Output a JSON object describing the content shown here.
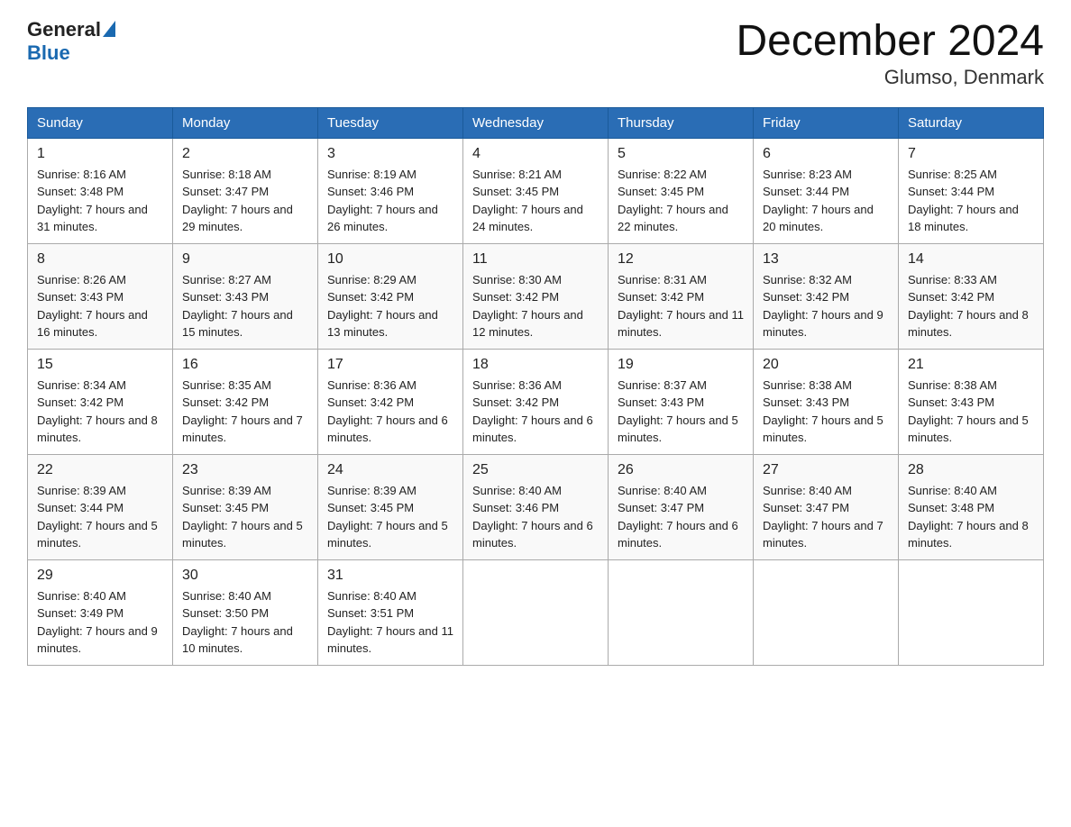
{
  "logo": {
    "general": "General",
    "blue": "Blue"
  },
  "title": "December 2024",
  "subtitle": "Glumso, Denmark",
  "days_of_week": [
    "Sunday",
    "Monday",
    "Tuesday",
    "Wednesday",
    "Thursday",
    "Friday",
    "Saturday"
  ],
  "weeks": [
    [
      {
        "day": "1",
        "sunrise": "8:16 AM",
        "sunset": "3:48 PM",
        "daylight": "7 hours and 31 minutes."
      },
      {
        "day": "2",
        "sunrise": "8:18 AM",
        "sunset": "3:47 PM",
        "daylight": "7 hours and 29 minutes."
      },
      {
        "day": "3",
        "sunrise": "8:19 AM",
        "sunset": "3:46 PM",
        "daylight": "7 hours and 26 minutes."
      },
      {
        "day": "4",
        "sunrise": "8:21 AM",
        "sunset": "3:45 PM",
        "daylight": "7 hours and 24 minutes."
      },
      {
        "day": "5",
        "sunrise": "8:22 AM",
        "sunset": "3:45 PM",
        "daylight": "7 hours and 22 minutes."
      },
      {
        "day": "6",
        "sunrise": "8:23 AM",
        "sunset": "3:44 PM",
        "daylight": "7 hours and 20 minutes."
      },
      {
        "day": "7",
        "sunrise": "8:25 AM",
        "sunset": "3:44 PM",
        "daylight": "7 hours and 18 minutes."
      }
    ],
    [
      {
        "day": "8",
        "sunrise": "8:26 AM",
        "sunset": "3:43 PM",
        "daylight": "7 hours and 16 minutes."
      },
      {
        "day": "9",
        "sunrise": "8:27 AM",
        "sunset": "3:43 PM",
        "daylight": "7 hours and 15 minutes."
      },
      {
        "day": "10",
        "sunrise": "8:29 AM",
        "sunset": "3:42 PM",
        "daylight": "7 hours and 13 minutes."
      },
      {
        "day": "11",
        "sunrise": "8:30 AM",
        "sunset": "3:42 PM",
        "daylight": "7 hours and 12 minutes."
      },
      {
        "day": "12",
        "sunrise": "8:31 AM",
        "sunset": "3:42 PM",
        "daylight": "7 hours and 11 minutes."
      },
      {
        "day": "13",
        "sunrise": "8:32 AM",
        "sunset": "3:42 PM",
        "daylight": "7 hours and 9 minutes."
      },
      {
        "day": "14",
        "sunrise": "8:33 AM",
        "sunset": "3:42 PM",
        "daylight": "7 hours and 8 minutes."
      }
    ],
    [
      {
        "day": "15",
        "sunrise": "8:34 AM",
        "sunset": "3:42 PM",
        "daylight": "7 hours and 8 minutes."
      },
      {
        "day": "16",
        "sunrise": "8:35 AM",
        "sunset": "3:42 PM",
        "daylight": "7 hours and 7 minutes."
      },
      {
        "day": "17",
        "sunrise": "8:36 AM",
        "sunset": "3:42 PM",
        "daylight": "7 hours and 6 minutes."
      },
      {
        "day": "18",
        "sunrise": "8:36 AM",
        "sunset": "3:42 PM",
        "daylight": "7 hours and 6 minutes."
      },
      {
        "day": "19",
        "sunrise": "8:37 AM",
        "sunset": "3:43 PM",
        "daylight": "7 hours and 5 minutes."
      },
      {
        "day": "20",
        "sunrise": "8:38 AM",
        "sunset": "3:43 PM",
        "daylight": "7 hours and 5 minutes."
      },
      {
        "day": "21",
        "sunrise": "8:38 AM",
        "sunset": "3:43 PM",
        "daylight": "7 hours and 5 minutes."
      }
    ],
    [
      {
        "day": "22",
        "sunrise": "8:39 AM",
        "sunset": "3:44 PM",
        "daylight": "7 hours and 5 minutes."
      },
      {
        "day": "23",
        "sunrise": "8:39 AM",
        "sunset": "3:45 PM",
        "daylight": "7 hours and 5 minutes."
      },
      {
        "day": "24",
        "sunrise": "8:39 AM",
        "sunset": "3:45 PM",
        "daylight": "7 hours and 5 minutes."
      },
      {
        "day": "25",
        "sunrise": "8:40 AM",
        "sunset": "3:46 PM",
        "daylight": "7 hours and 6 minutes."
      },
      {
        "day": "26",
        "sunrise": "8:40 AM",
        "sunset": "3:47 PM",
        "daylight": "7 hours and 6 minutes."
      },
      {
        "day": "27",
        "sunrise": "8:40 AM",
        "sunset": "3:47 PM",
        "daylight": "7 hours and 7 minutes."
      },
      {
        "day": "28",
        "sunrise": "8:40 AM",
        "sunset": "3:48 PM",
        "daylight": "7 hours and 8 minutes."
      }
    ],
    [
      {
        "day": "29",
        "sunrise": "8:40 AM",
        "sunset": "3:49 PM",
        "daylight": "7 hours and 9 minutes."
      },
      {
        "day": "30",
        "sunrise": "8:40 AM",
        "sunset": "3:50 PM",
        "daylight": "7 hours and 10 minutes."
      },
      {
        "day": "31",
        "sunrise": "8:40 AM",
        "sunset": "3:51 PM",
        "daylight": "7 hours and 11 minutes."
      },
      null,
      null,
      null,
      null
    ]
  ]
}
